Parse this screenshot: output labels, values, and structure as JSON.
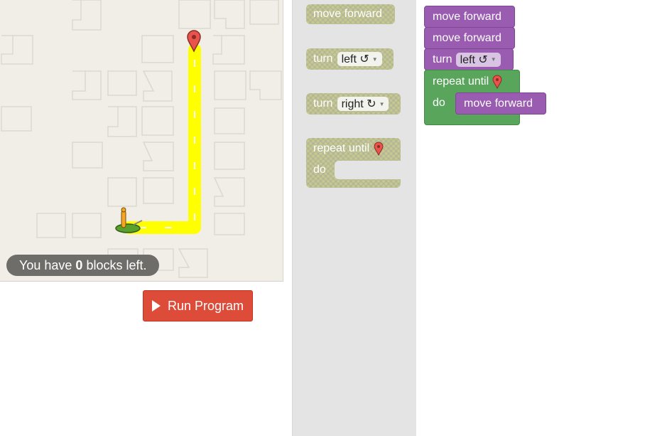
{
  "maze": {
    "capacity_prefix": "You have ",
    "capacity_count": "0",
    "capacity_suffix": " blocks left.",
    "path_color": "#ffff00",
    "goal_marker": "map-pin-icon",
    "player": "pegman-icon"
  },
  "run_button": {
    "label": "Run Program",
    "icon": "play-icon",
    "color": "#dd4b39"
  },
  "toolbox": {
    "move_forward": "move forward",
    "turn_left": {
      "label": "turn",
      "option": "left ↺"
    },
    "turn_right": {
      "label": "turn",
      "option": "right ↻"
    },
    "repeat_until": {
      "label": "repeat until",
      "do": "do",
      "icon": "map-pin-icon"
    }
  },
  "workspace": {
    "block_1": "move forward",
    "block_2": "move forward",
    "block_3": {
      "label": "turn",
      "option": "left ↺"
    },
    "repeat": {
      "label": "repeat until",
      "do": "do",
      "inner": "move forward",
      "icon": "map-pin-icon"
    },
    "colors": {
      "action": "#9a5cb0",
      "loop": "#58a55b"
    }
  }
}
